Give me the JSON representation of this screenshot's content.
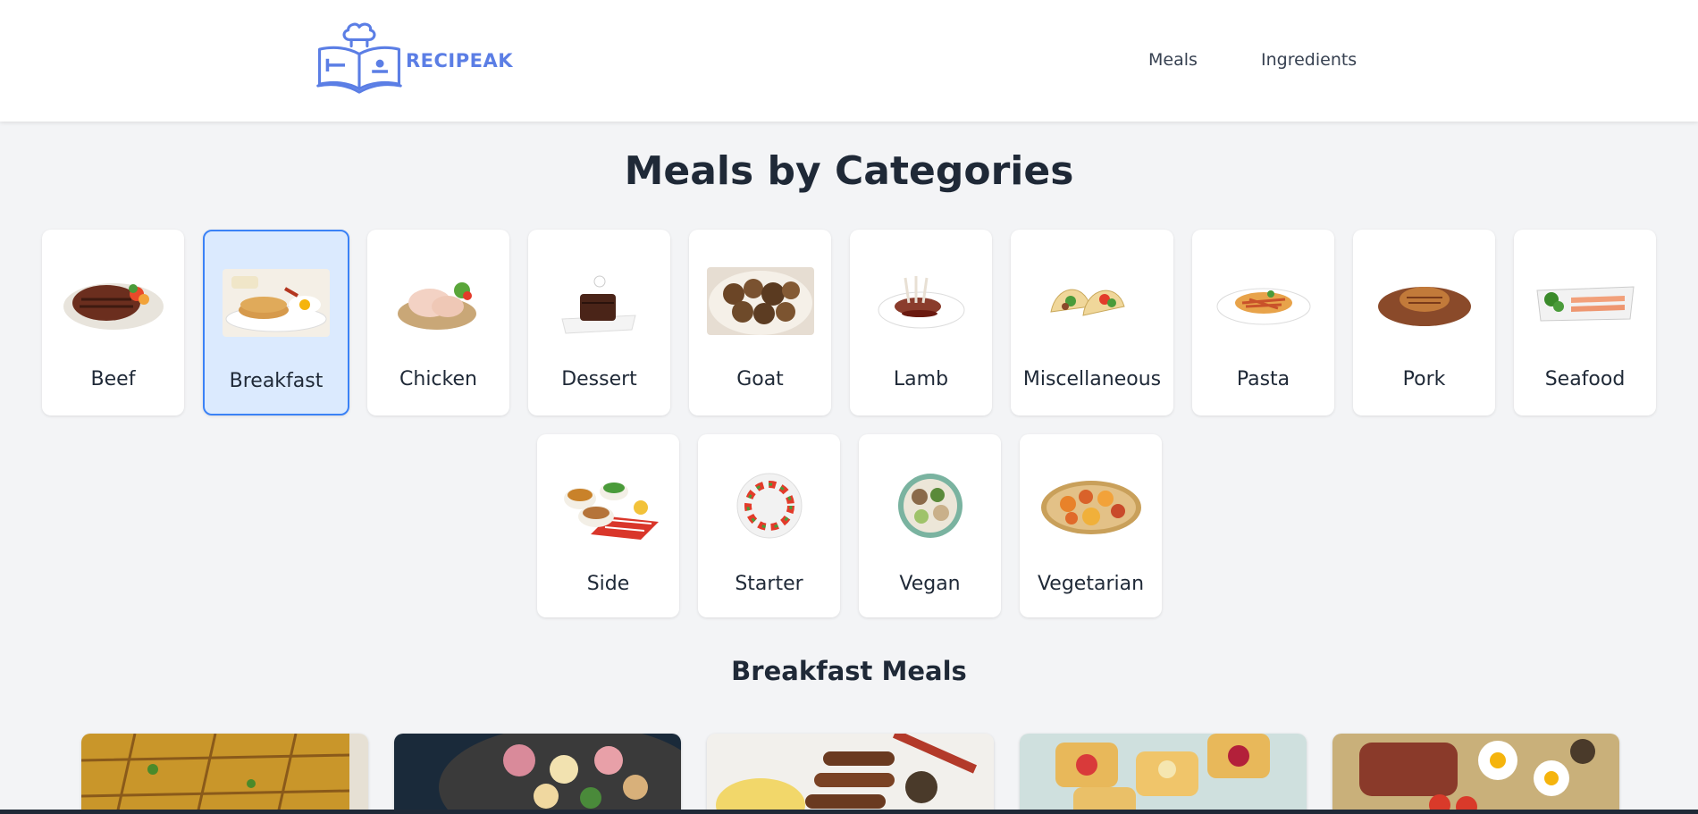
{
  "brand": {
    "name": "RECIPEAK",
    "color": "#5b7ee5",
    "icon": "chef-hat-book-icon"
  },
  "nav": {
    "links": [
      "Meals",
      "Ingredients"
    ]
  },
  "page": {
    "title": "Meals by Categories",
    "section_title": "Breakfast Meals"
  },
  "categories": [
    {
      "label": "Beef",
      "icon": "beef-image",
      "selected": false
    },
    {
      "label": "Breakfast",
      "icon": "breakfast-image",
      "selected": true
    },
    {
      "label": "Chicken",
      "icon": "chicken-image",
      "selected": false
    },
    {
      "label": "Dessert",
      "icon": "dessert-image",
      "selected": false
    },
    {
      "label": "Goat",
      "icon": "goat-image",
      "selected": false
    },
    {
      "label": "Lamb",
      "icon": "lamb-image",
      "selected": false
    },
    {
      "label": "Miscellaneous",
      "icon": "miscellaneous-image",
      "selected": false
    },
    {
      "label": "Pasta",
      "icon": "pasta-image",
      "selected": false
    },
    {
      "label": "Pork",
      "icon": "pork-image",
      "selected": false
    },
    {
      "label": "Seafood",
      "icon": "seafood-image",
      "selected": false
    },
    {
      "label": "Side",
      "icon": "side-image",
      "selected": false
    },
    {
      "label": "Starter",
      "icon": "starter-image",
      "selected": false
    },
    {
      "label": "Vegan",
      "icon": "vegan-image",
      "selected": false
    },
    {
      "label": "Vegetarian",
      "icon": "vegetarian-image",
      "selected": false
    }
  ],
  "meals": [
    {
      "icon": "meal-image"
    },
    {
      "icon": "meal-image"
    },
    {
      "icon": "meal-image"
    },
    {
      "icon": "meal-image"
    },
    {
      "icon": "meal-image"
    }
  ],
  "colors": {
    "accent": "#3b82f6",
    "selected_bg": "#dbeafe",
    "page_bg": "#f3f4f6"
  }
}
